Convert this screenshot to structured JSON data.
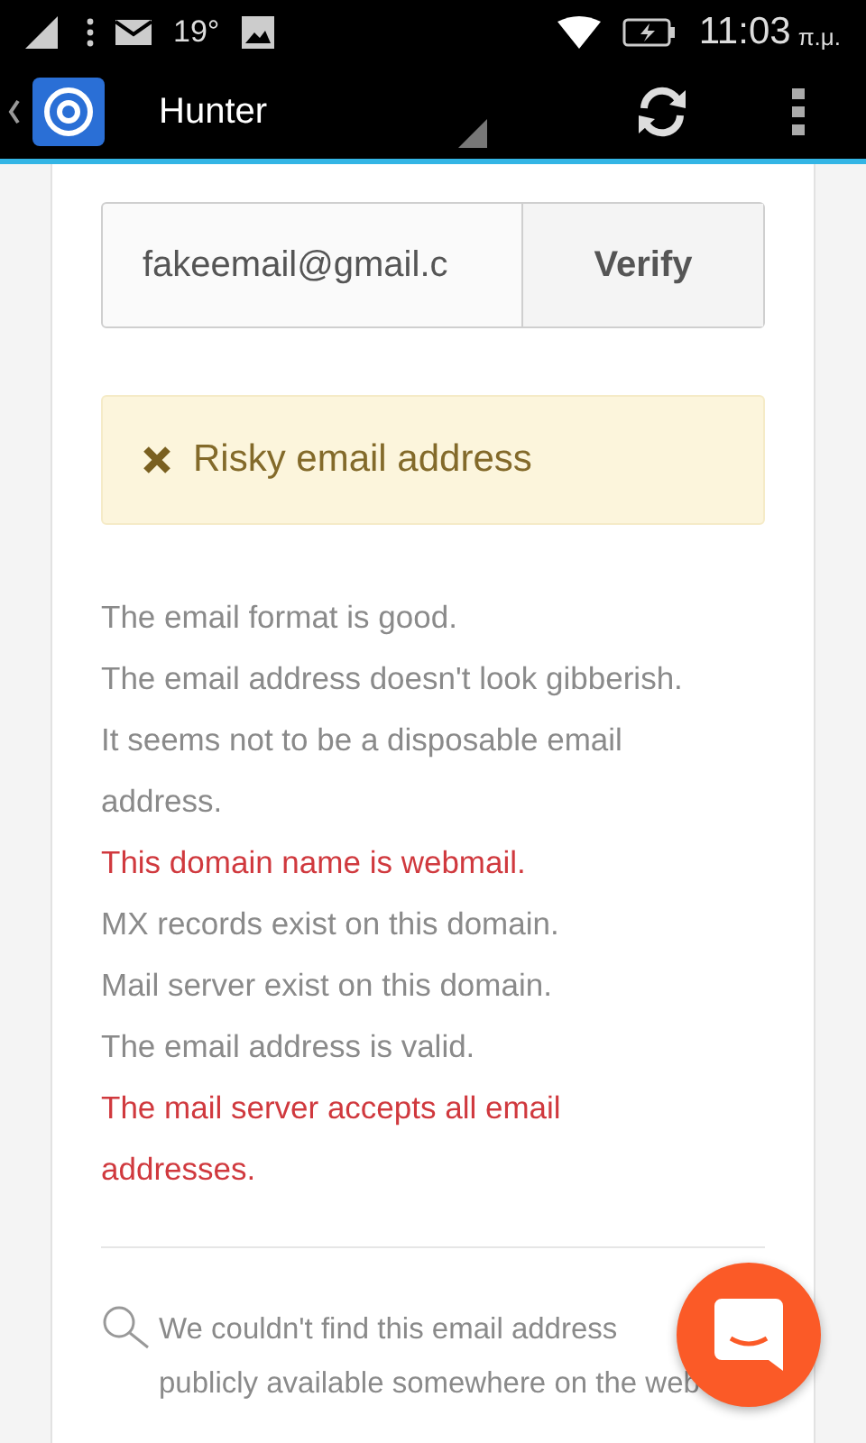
{
  "status_bar": {
    "temperature": "19°",
    "time": "11:03",
    "period": "π.μ."
  },
  "app_bar": {
    "title": "Hunter"
  },
  "verify_form": {
    "email": "fakeemail@gmail.c",
    "button": "Verify"
  },
  "alert": {
    "text": "Risky email address"
  },
  "checks": [
    {
      "text": "The email format is good.",
      "kind": "pass"
    },
    {
      "text": "The email address doesn't look gibberish.",
      "kind": "pass"
    },
    {
      "text": "It seems not to be a disposable email address.",
      "kind": "pass"
    },
    {
      "text": "This domain name is webmail.",
      "kind": "fail"
    },
    {
      "text": "MX records exist on this domain.",
      "kind": "pass"
    },
    {
      "text": "Mail server exist on this domain.",
      "kind": "pass"
    },
    {
      "text": "The email address is valid.",
      "kind": "pass"
    },
    {
      "text": "The mail server accepts all email addresses.",
      "kind": "fail"
    }
  ],
  "sources": {
    "text": "We couldn't find this email address publicly available somewhere on the web"
  }
}
